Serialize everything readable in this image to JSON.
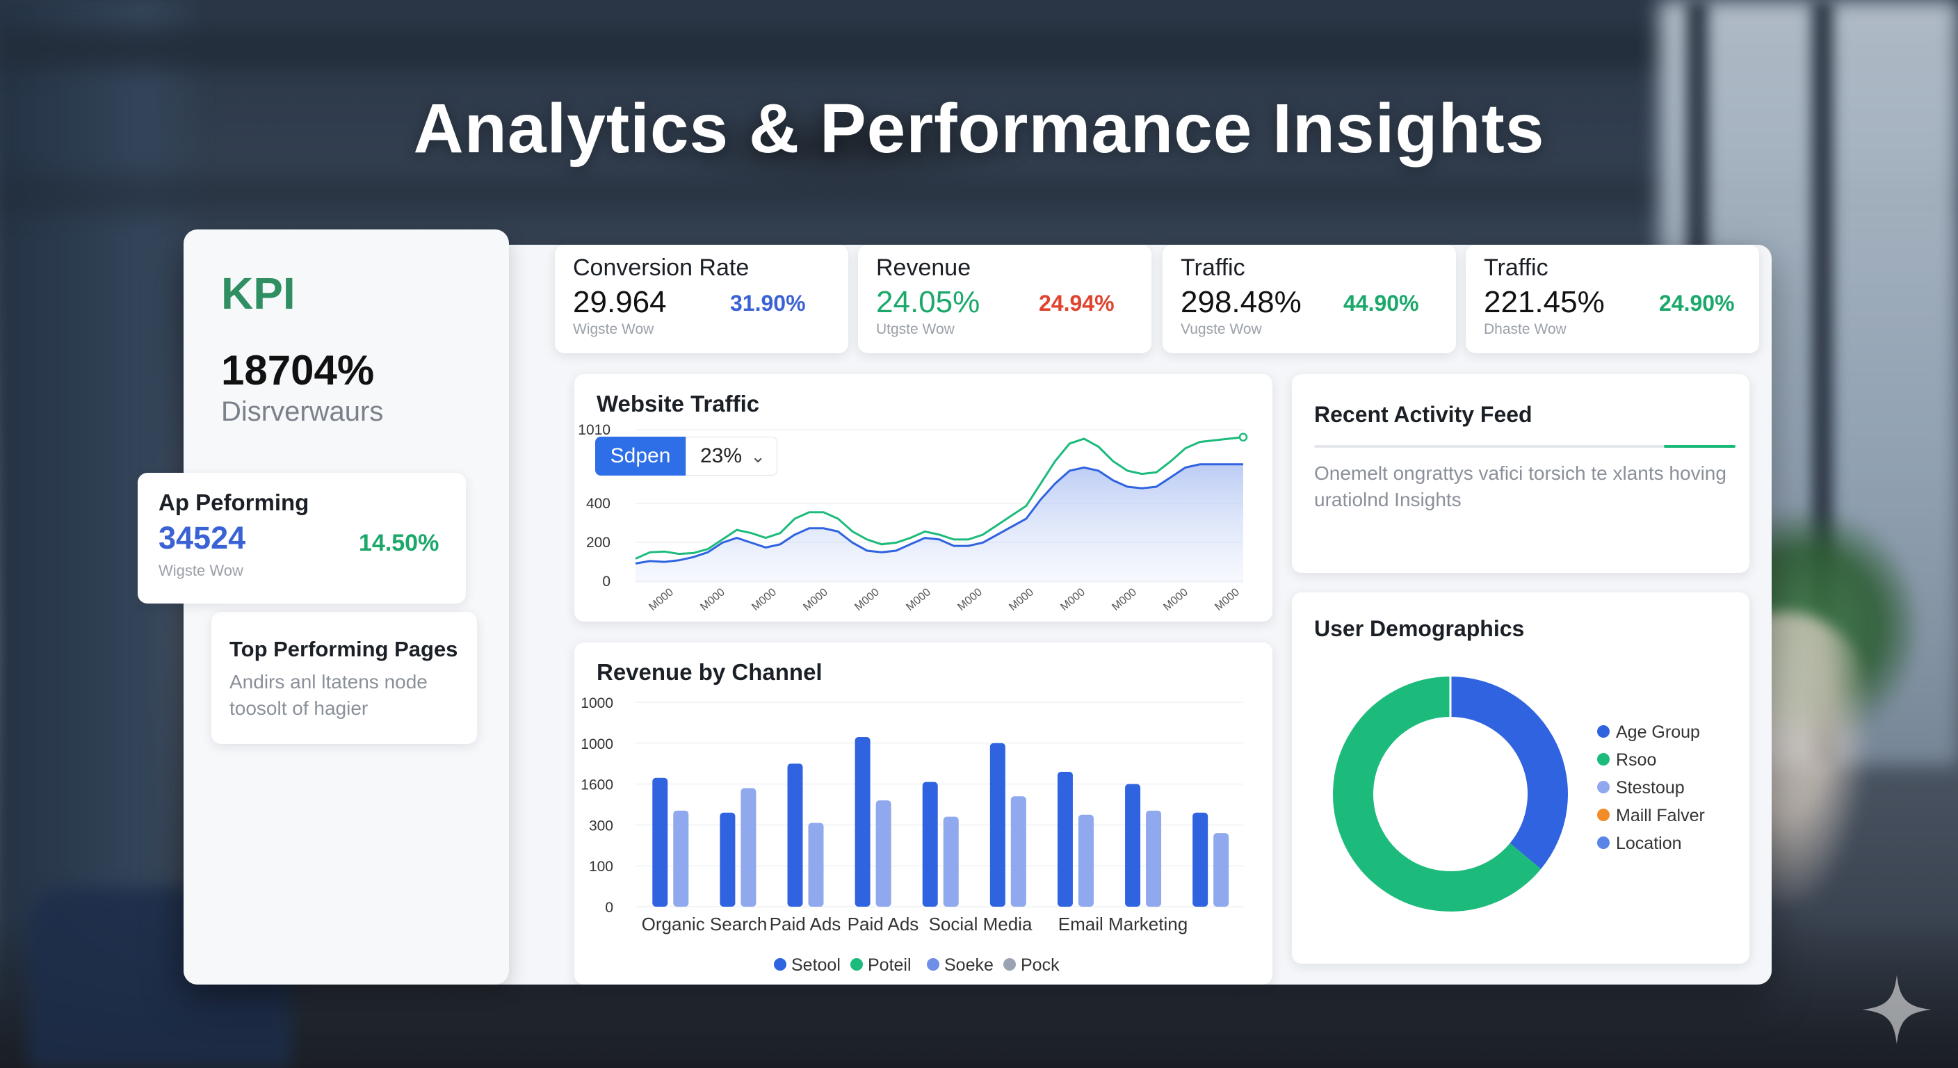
{
  "page": {
    "title": "Analytics & Performance Insights"
  },
  "kpi": {
    "title": "KPI",
    "value": "18704%",
    "subtitle": "Disrverwaurs"
  },
  "ap_performing": {
    "title": "Ap Peforming",
    "value": "34524",
    "percent": "14.50%",
    "subtitle": "Wigste Wow"
  },
  "top_pages": {
    "title": "Top Performing Pages",
    "text": "Andirs anl ltatens node toosolt of hagier"
  },
  "metrics": [
    {
      "label": "Conversion Rate",
      "value": "29.964",
      "percent": "31.90%",
      "subtitle": "Wigste Wow",
      "value_color": "#111111",
      "percent_color": "#3a62d4"
    },
    {
      "label": "Revenue",
      "value": "24.05%",
      "percent": "24.94%",
      "subtitle": "Utgste Wow",
      "value_color": "#1ba86a",
      "percent_color": "#e0442f"
    },
    {
      "label": "Traffic",
      "value": "298.48%",
      "percent": "44.90%",
      "subtitle": "Vugste Wow",
      "value_color": "#111111",
      "percent_color": "#1ba86a"
    },
    {
      "label": "Traffic",
      "value": "221.45%",
      "percent": "24.90%",
      "subtitle": "Dhaste Wow",
      "value_color": "#111111",
      "percent_color": "#1ba86a"
    }
  ],
  "traffic_filter": {
    "button": "Sdpen",
    "select_value": "23%"
  },
  "activity": {
    "title": "Recent Activity Feed",
    "text": "Onemelt ongrattys vafici torsich te xlants hoving uratiolnd Insights",
    "progress": 0.17
  },
  "colors": {
    "blue": "#2f63e0",
    "green": "#1cbb7c",
    "light_blue": "#8fa8ee",
    "orange": "#f28c28",
    "accent_title": "#2f8e62"
  },
  "icons": {
    "chevron": "chevron-down-icon",
    "sparkle": "sparkle-icon"
  },
  "chart_data": [
    {
      "type": "area",
      "title": "Website Traffic",
      "y_ticks": [
        "1010",
        "400",
        "200",
        "0"
      ],
      "x_ticks": [
        "M000",
        "M000",
        "M000",
        "M000",
        "M000",
        "M000",
        "M000",
        "M000",
        "M000",
        "M000",
        "M000",
        "M000"
      ],
      "ylim": [
        0,
        1000
      ],
      "x": [
        0,
        1,
        2,
        3,
        4,
        5,
        6,
        7,
        8,
        9,
        10,
        11,
        12,
        13,
        14,
        15,
        16,
        17,
        18,
        19,
        20,
        21,
        22,
        23,
        24,
        25,
        26,
        27,
        28,
        29,
        30,
        31,
        32,
        33,
        34,
        35,
        36,
        37,
        38,
        39,
        40,
        41,
        42
      ],
      "series": [
        {
          "values": [
            120,
            135,
            130,
            140,
            160,
            190,
            250,
            280,
            250,
            220,
            240,
            300,
            340,
            340,
            320,
            250,
            200,
            190,
            200,
            240,
            280,
            270,
            230,
            230,
            250,
            300,
            350,
            400,
            520,
            620,
            700,
            720,
            700,
            640,
            600,
            590,
            600,
            660,
            720,
            740,
            740,
            740,
            740
          ]
        },
        {
          "values": [
            150,
            190,
            195,
            180,
            185,
            210,
            270,
            330,
            310,
            280,
            310,
            400,
            440,
            440,
            400,
            320,
            270,
            240,
            250,
            280,
            320,
            300,
            270,
            270,
            300,
            360,
            420,
            480,
            620,
            760,
            870,
            900,
            850,
            760,
            700,
            680,
            690,
            760,
            840,
            880,
            890,
            900,
            910
          ]
        }
      ]
    },
    {
      "type": "bar",
      "title": "Revenue by Channel",
      "y_ticks": [
        "1000",
        "1000",
        "1600",
        "300",
        "100",
        "0"
      ],
      "ylim": [
        0,
        500
      ],
      "category_labels": [
        "Organic Search",
        "Paid Ads",
        "Paid Ads",
        "Social Media",
        "Email Marketing"
      ],
      "groups": [
        [
          315,
          235
        ],
        [
          230,
          290
        ],
        [
          350,
          205
        ],
        [
          415,
          260
        ],
        [
          305,
          220
        ],
        [
          400,
          270
        ],
        [
          330,
          225
        ],
        [
          300,
          235
        ],
        [
          230,
          180
        ]
      ],
      "legend": [
        "Setool",
        "Poteil",
        "Soeke",
        "Pock"
      ],
      "legend_colors": [
        "#2f63e0",
        "#1cbb7c",
        "#6f8fe6",
        "#9aa3b2"
      ]
    },
    {
      "type": "pie",
      "title": "User Demographics",
      "donut": true,
      "values": [
        36,
        64
      ],
      "slice_colors": [
        "#2f63e0",
        "#1cbb7c"
      ],
      "legend": [
        "Age Group",
        "Rsoo",
        "Stestoup",
        "Maill Falver",
        "Location"
      ],
      "legend_colors": [
        "#2f63e0",
        "#1cbb7c",
        "#8fa8ee",
        "#f28c28",
        "#5a84e6"
      ]
    }
  ]
}
